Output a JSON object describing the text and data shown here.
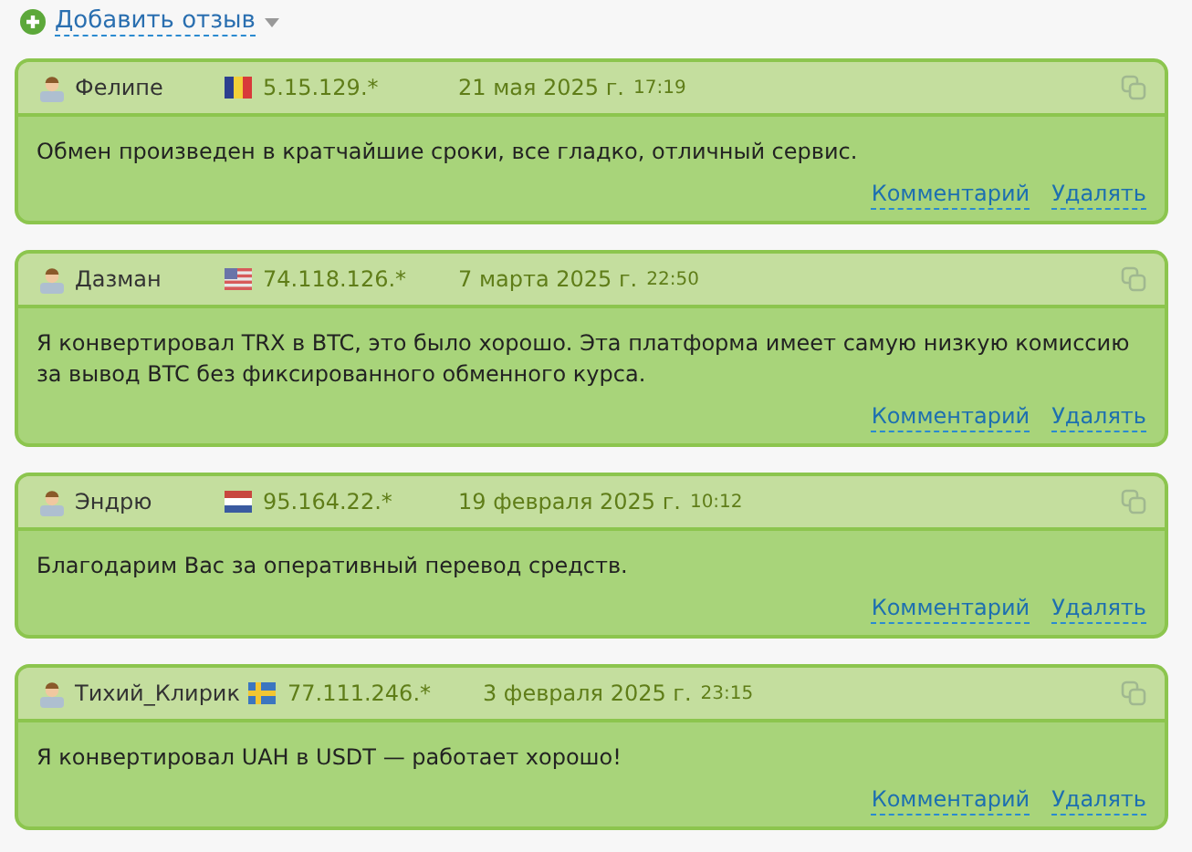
{
  "add_review": {
    "label": "Добавить отзыв"
  },
  "reviews": [
    {
      "author": "Фелипе",
      "flag": {
        "kind": "ro"
      },
      "ip": "5.15.129.*",
      "date": "21 мая 2025 г.",
      "time": "17:19",
      "text": "Обмен произведен в кратчайшие сроки, все гладко, отличный сервис.",
      "actions": [
        "Комментарий",
        "Удалять"
      ]
    },
    {
      "author": "Дазман",
      "flag": {
        "kind": "us"
      },
      "ip": "74.118.126.*",
      "date": "7 марта 2025 г.",
      "time": "22:50",
      "text": "Я конвертировал TRX в BTC, это было хорошо. Эта платформа имеет самую низкую комиссию за вывод BTC без фиксированного обменного курса.",
      "actions": [
        "Комментарий",
        "Удалять"
      ]
    },
    {
      "author": "Эндрю",
      "flag": {
        "kind": "nl"
      },
      "ip": "95.164.22.*",
      "date": "19 февраля 2025 г.",
      "time": "10:12",
      "text": "Благодарим Вас за оперативный перевод средств.",
      "actions": [
        "Комментарий",
        "Удалять"
      ]
    },
    {
      "author": "Тихий_Клирик",
      "flag": {
        "kind": "se"
      },
      "ip": "77.111.246.*",
      "date": "3 февраля 2025 г.",
      "time": "23:15",
      "text": "Я конвертировал UAH в USDT — работает хорошо!",
      "actions": [
        "Комментарий",
        "Удалять"
      ]
    }
  ]
}
